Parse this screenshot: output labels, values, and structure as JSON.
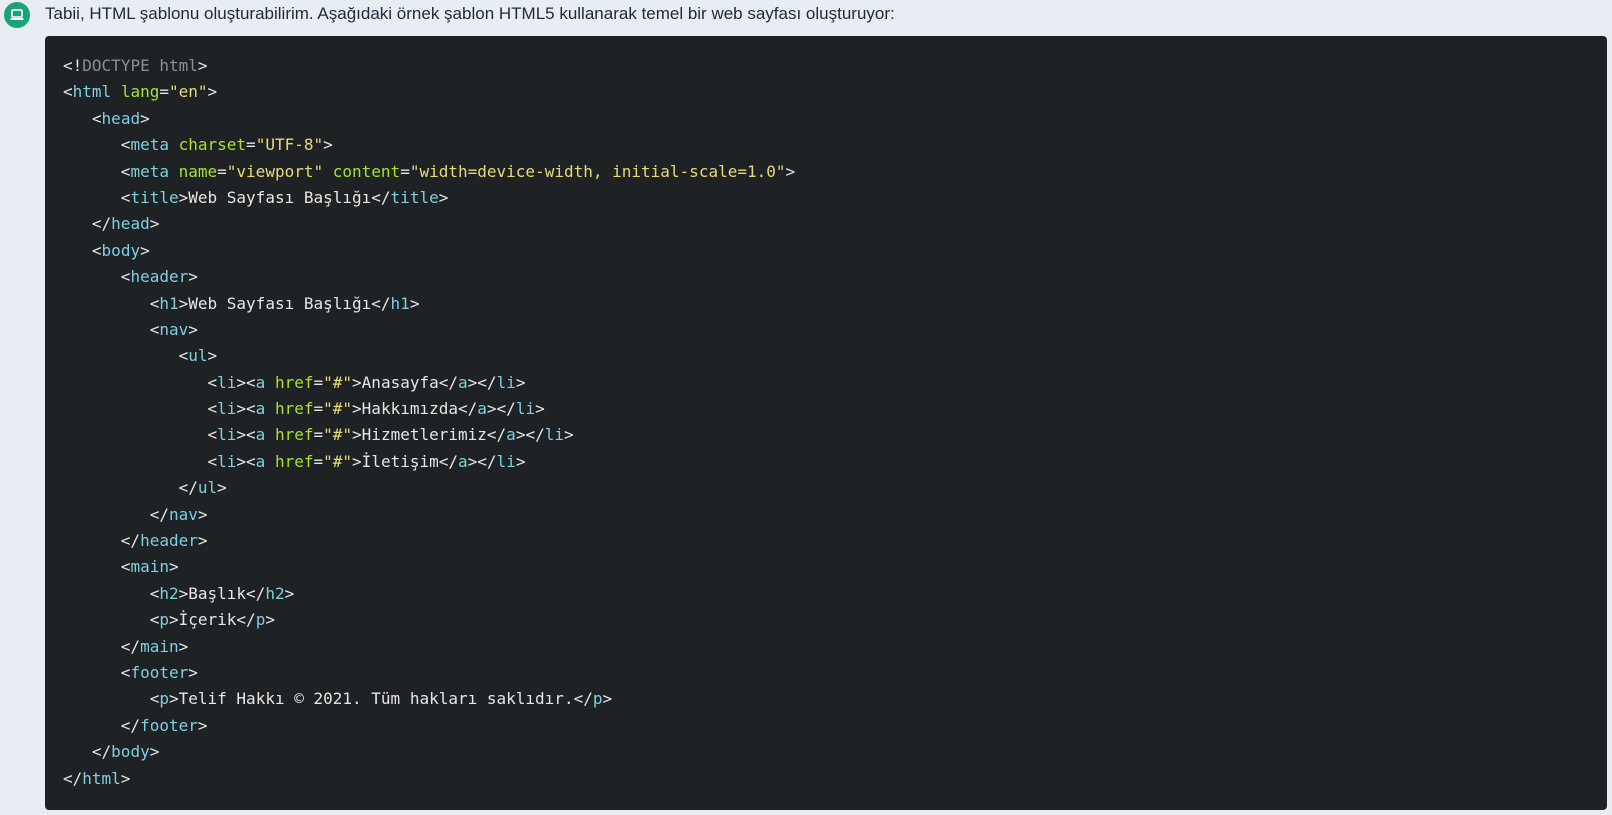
{
  "avatar": {
    "icon": "laptop-icon",
    "color": "#1aa37a"
  },
  "message": {
    "text": "Tabii, HTML şablonu oluşturabilirim. Aşağıdaki örnek şablon HTML5 kullanarak temel bir web sayfası oluşturuyor:"
  },
  "colors": {
    "code_bg": "#1f2225",
    "tag": "#7fcfe0",
    "attr": "#a6e22e",
    "string": "#e6db74",
    "text": "#e6e6e6",
    "doctype": "#8a8f94"
  },
  "code": {
    "lines": [
      [
        [
          "punc",
          "<"
        ],
        [
          "punc",
          "!"
        ],
        [
          "doctype",
          "DOCTYPE html"
        ],
        [
          "punc",
          ">"
        ]
      ],
      [
        [
          "punc",
          "<"
        ],
        [
          "tag",
          "html"
        ],
        [
          "text",
          " "
        ],
        [
          "attr",
          "lang"
        ],
        [
          "punc",
          "="
        ],
        [
          "str",
          "\"en\""
        ],
        [
          "punc",
          ">"
        ]
      ],
      [
        [
          "text",
          "   "
        ],
        [
          "punc",
          "<"
        ],
        [
          "tag",
          "head"
        ],
        [
          "punc",
          ">"
        ]
      ],
      [
        [
          "text",
          "      "
        ],
        [
          "punc",
          "<"
        ],
        [
          "tag",
          "meta"
        ],
        [
          "text",
          " "
        ],
        [
          "attr",
          "charset"
        ],
        [
          "punc",
          "="
        ],
        [
          "str",
          "\"UTF-8\""
        ],
        [
          "punc",
          ">"
        ]
      ],
      [
        [
          "text",
          "      "
        ],
        [
          "punc",
          "<"
        ],
        [
          "tag",
          "meta"
        ],
        [
          "text",
          " "
        ],
        [
          "attr",
          "name"
        ],
        [
          "punc",
          "="
        ],
        [
          "str",
          "\"viewport\""
        ],
        [
          "text",
          " "
        ],
        [
          "attr",
          "content"
        ],
        [
          "punc",
          "="
        ],
        [
          "str",
          "\"width=device-width, initial-scale=1.0\""
        ],
        [
          "punc",
          ">"
        ]
      ],
      [
        [
          "text",
          "      "
        ],
        [
          "punc",
          "<"
        ],
        [
          "tag",
          "title"
        ],
        [
          "punc",
          ">"
        ],
        [
          "text",
          "Web Sayfası Başlığı"
        ],
        [
          "punc",
          "</"
        ],
        [
          "tag",
          "title"
        ],
        [
          "punc",
          ">"
        ]
      ],
      [
        [
          "text",
          "   "
        ],
        [
          "punc",
          "</"
        ],
        [
          "tag",
          "head"
        ],
        [
          "punc",
          ">"
        ]
      ],
      [
        [
          "text",
          "   "
        ],
        [
          "punc",
          "<"
        ],
        [
          "tag",
          "body"
        ],
        [
          "punc",
          ">"
        ]
      ],
      [
        [
          "text",
          "      "
        ],
        [
          "punc",
          "<"
        ],
        [
          "tag",
          "header"
        ],
        [
          "punc",
          ">"
        ]
      ],
      [
        [
          "text",
          "         "
        ],
        [
          "punc",
          "<"
        ],
        [
          "tag",
          "h1"
        ],
        [
          "punc",
          ">"
        ],
        [
          "text",
          "Web Sayfası Başlığı"
        ],
        [
          "punc",
          "</"
        ],
        [
          "tag",
          "h1"
        ],
        [
          "punc",
          ">"
        ]
      ],
      [
        [
          "text",
          "         "
        ],
        [
          "punc",
          "<"
        ],
        [
          "tag",
          "nav"
        ],
        [
          "punc",
          ">"
        ]
      ],
      [
        [
          "text",
          "            "
        ],
        [
          "punc",
          "<"
        ],
        [
          "tag",
          "ul"
        ],
        [
          "punc",
          ">"
        ]
      ],
      [
        [
          "text",
          "               "
        ],
        [
          "punc",
          "<"
        ],
        [
          "tag",
          "li"
        ],
        [
          "punc",
          "><"
        ],
        [
          "tag",
          "a"
        ],
        [
          "text",
          " "
        ],
        [
          "attr",
          "href"
        ],
        [
          "punc",
          "="
        ],
        [
          "str",
          "\"#\""
        ],
        [
          "punc",
          ">"
        ],
        [
          "text",
          "Anasayfa"
        ],
        [
          "punc",
          "</"
        ],
        [
          "tag",
          "a"
        ],
        [
          "punc",
          "></"
        ],
        [
          "tag",
          "li"
        ],
        [
          "punc",
          ">"
        ]
      ],
      [
        [
          "text",
          "               "
        ],
        [
          "punc",
          "<"
        ],
        [
          "tag",
          "li"
        ],
        [
          "punc",
          "><"
        ],
        [
          "tag",
          "a"
        ],
        [
          "text",
          " "
        ],
        [
          "attr",
          "href"
        ],
        [
          "punc",
          "="
        ],
        [
          "str",
          "\"#\""
        ],
        [
          "punc",
          ">"
        ],
        [
          "text",
          "Hakkımızda"
        ],
        [
          "punc",
          "</"
        ],
        [
          "tag",
          "a"
        ],
        [
          "punc",
          "></"
        ],
        [
          "tag",
          "li"
        ],
        [
          "punc",
          ">"
        ]
      ],
      [
        [
          "text",
          "               "
        ],
        [
          "punc",
          "<"
        ],
        [
          "tag",
          "li"
        ],
        [
          "punc",
          "><"
        ],
        [
          "tag",
          "a"
        ],
        [
          "text",
          " "
        ],
        [
          "attr",
          "href"
        ],
        [
          "punc",
          "="
        ],
        [
          "str",
          "\"#\""
        ],
        [
          "punc",
          ">"
        ],
        [
          "text",
          "Hizmetlerimiz"
        ],
        [
          "punc",
          "</"
        ],
        [
          "tag",
          "a"
        ],
        [
          "punc",
          "></"
        ],
        [
          "tag",
          "li"
        ],
        [
          "punc",
          ">"
        ]
      ],
      [
        [
          "text",
          "               "
        ],
        [
          "punc",
          "<"
        ],
        [
          "tag",
          "li"
        ],
        [
          "punc",
          "><"
        ],
        [
          "tag",
          "a"
        ],
        [
          "text",
          " "
        ],
        [
          "attr",
          "href"
        ],
        [
          "punc",
          "="
        ],
        [
          "str",
          "\"#\""
        ],
        [
          "punc",
          ">"
        ],
        [
          "text",
          "İletişim"
        ],
        [
          "punc",
          "</"
        ],
        [
          "tag",
          "a"
        ],
        [
          "punc",
          "></"
        ],
        [
          "tag",
          "li"
        ],
        [
          "punc",
          ">"
        ]
      ],
      [
        [
          "text",
          "            "
        ],
        [
          "punc",
          "</"
        ],
        [
          "tag",
          "ul"
        ],
        [
          "punc",
          ">"
        ]
      ],
      [
        [
          "text",
          "         "
        ],
        [
          "punc",
          "</"
        ],
        [
          "tag",
          "nav"
        ],
        [
          "punc",
          ">"
        ]
      ],
      [
        [
          "text",
          "      "
        ],
        [
          "punc",
          "</"
        ],
        [
          "tag",
          "header"
        ],
        [
          "punc",
          ">"
        ]
      ],
      [
        [
          "text",
          "      "
        ],
        [
          "punc",
          "<"
        ],
        [
          "tag",
          "main"
        ],
        [
          "punc",
          ">"
        ]
      ],
      [
        [
          "text",
          "         "
        ],
        [
          "punc",
          "<"
        ],
        [
          "tag",
          "h2"
        ],
        [
          "punc",
          ">"
        ],
        [
          "text",
          "Başlık"
        ],
        [
          "punc",
          "</"
        ],
        [
          "tag",
          "h2"
        ],
        [
          "punc",
          ">"
        ]
      ],
      [
        [
          "text",
          "         "
        ],
        [
          "punc",
          "<"
        ],
        [
          "tag",
          "p"
        ],
        [
          "punc",
          ">"
        ],
        [
          "text",
          "İçerik"
        ],
        [
          "punc",
          "</"
        ],
        [
          "tag",
          "p"
        ],
        [
          "punc",
          ">"
        ]
      ],
      [
        [
          "text",
          "      "
        ],
        [
          "punc",
          "</"
        ],
        [
          "tag",
          "main"
        ],
        [
          "punc",
          ">"
        ]
      ],
      [
        [
          "text",
          "      "
        ],
        [
          "punc",
          "<"
        ],
        [
          "tag",
          "footer"
        ],
        [
          "punc",
          ">"
        ]
      ],
      [
        [
          "text",
          "         "
        ],
        [
          "punc",
          "<"
        ],
        [
          "tag",
          "p"
        ],
        [
          "punc",
          ">"
        ],
        [
          "text",
          "Telif Hakkı © 2021. Tüm hakları saklıdır."
        ],
        [
          "punc",
          "</"
        ],
        [
          "tag",
          "p"
        ],
        [
          "punc",
          ">"
        ]
      ],
      [
        [
          "text",
          "      "
        ],
        [
          "punc",
          "</"
        ],
        [
          "tag",
          "footer"
        ],
        [
          "punc",
          ">"
        ]
      ],
      [
        [
          "text",
          "   "
        ],
        [
          "punc",
          "</"
        ],
        [
          "tag",
          "body"
        ],
        [
          "punc",
          ">"
        ]
      ],
      [
        [
          "punc",
          "</"
        ],
        [
          "tag",
          "html"
        ],
        [
          "punc",
          ">"
        ]
      ]
    ]
  }
}
